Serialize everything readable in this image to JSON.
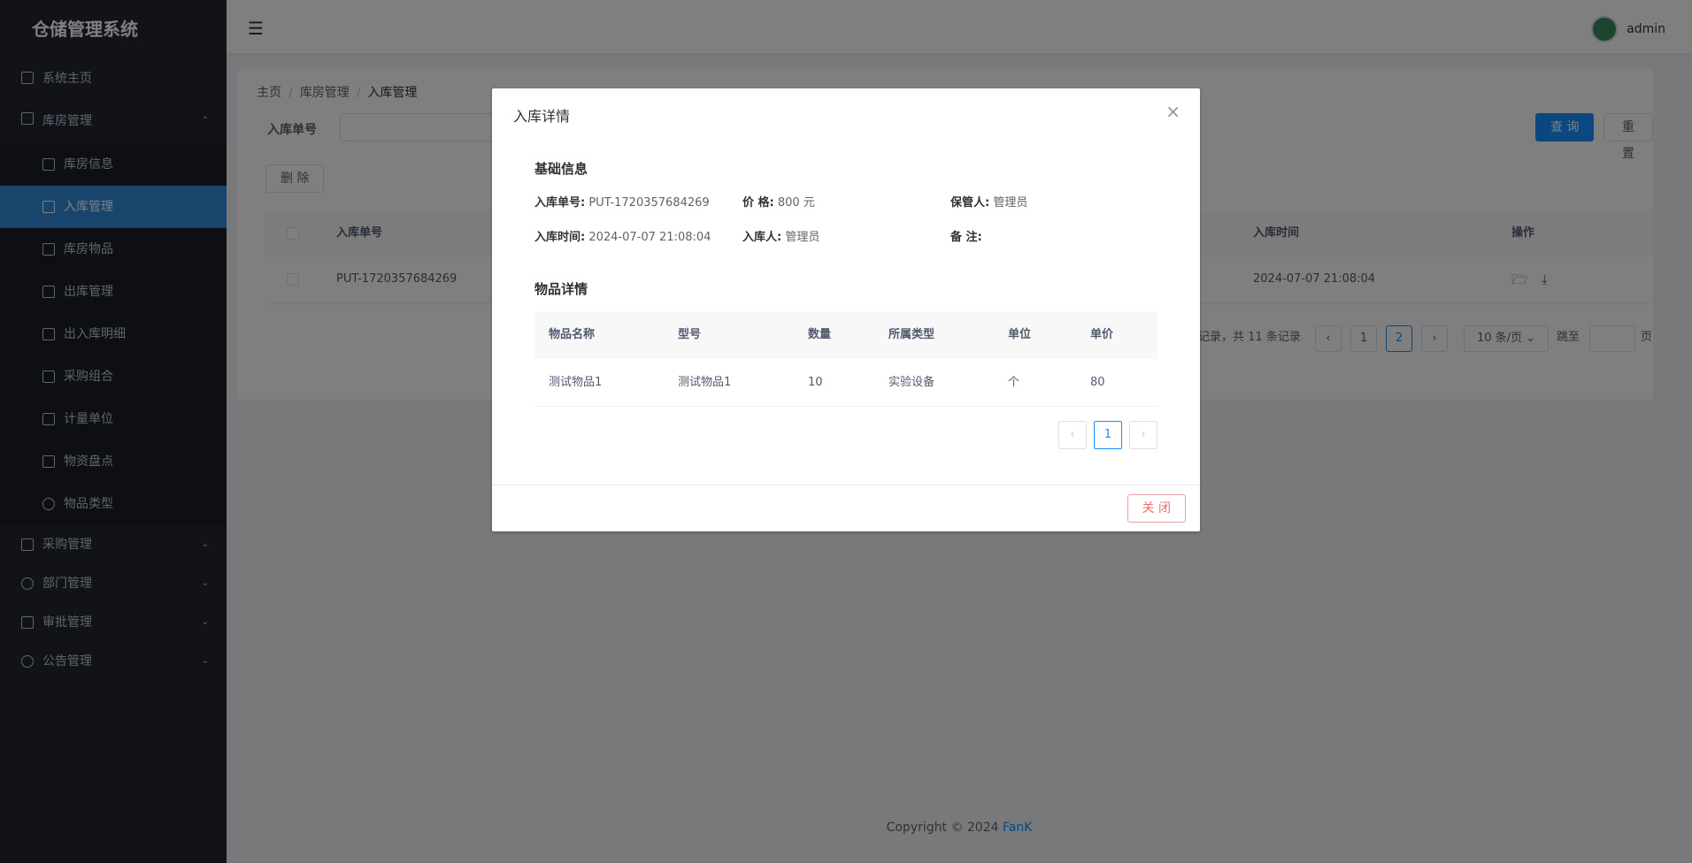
{
  "app": {
    "title": "仓储管理系统"
  },
  "sidebar": {
    "items": [
      {
        "label": "系统主页",
        "icon": "home-icon"
      },
      {
        "label": "库房管理",
        "icon": "lock-icon",
        "arrow": "⌃"
      },
      {
        "label": "库房信息",
        "icon": "card-icon"
      },
      {
        "label": "入库管理",
        "icon": "inbox-icon"
      },
      {
        "label": "库房物品",
        "icon": "grid-icon"
      },
      {
        "label": "出库管理",
        "icon": "people-icon"
      },
      {
        "label": "出入库明细",
        "icon": "chart-icon"
      },
      {
        "label": "采购组合",
        "icon": "box-icon"
      },
      {
        "label": "计量单位",
        "icon": "barcode-icon"
      },
      {
        "label": "物资盘点",
        "icon": "doc-icon"
      },
      {
        "label": "物品类型",
        "icon": "spinner-icon"
      },
      {
        "label": "采购管理",
        "icon": "doc-icon",
        "arrow": "⌄"
      },
      {
        "label": "部门管理",
        "icon": "user-icon",
        "arrow": "⌄"
      },
      {
        "label": "审批管理",
        "icon": "frame-icon",
        "arrow": "⌄"
      },
      {
        "label": "公告管理",
        "icon": "chat-icon",
        "arrow": "⌄"
      }
    ]
  },
  "header": {
    "menu_icon": "hamburger-icon",
    "username": "admin"
  },
  "breadcrumb": {
    "home": "主页",
    "parent": "库房管理",
    "current": "入库管理"
  },
  "search": {
    "label": "入库单号",
    "query_label": "查 询",
    "reset_label": "重 置"
  },
  "toolbar": {
    "delete_label": "删 除"
  },
  "table": {
    "headers": {
      "code": "入库单号",
      "time": "入库时间",
      "ops": "操作"
    },
    "rows": [
      {
        "code": "PUT-1720357684269",
        "time": "2024-07-07 21:08:04"
      }
    ]
  },
  "pagination": {
    "summary": "记录，共 11 条记录",
    "pages": [
      "1",
      "2"
    ],
    "page_size": "10 条/页",
    "goto_label": "跳至",
    "page_suffix": "页"
  },
  "footer": {
    "copyright": "Copyright © 2024",
    "author": "FanK"
  },
  "modal": {
    "title": "入库详情",
    "basic_section": "基础信息",
    "fields": {
      "code_label": "入库单号:",
      "code_value": "PUT-1720357684269",
      "price_label": "价 格:",
      "price_value": "800 元",
      "keeper_label": "保管人:",
      "keeper_value": "管理员",
      "time_label": "入库时间:",
      "time_value": "2024-07-07 21:08:04",
      "person_label": "入库人:",
      "person_value": "管理员",
      "note_label": "备 注:",
      "note_value": ""
    },
    "items_section": "物品详情",
    "item_headers": [
      "物品名称",
      "型号",
      "数量",
      "所属类型",
      "单位",
      "单价"
    ],
    "item_rows": [
      [
        "测试物品1",
        "测试物品1",
        "10",
        "实验设备",
        "个",
        "80"
      ]
    ],
    "page": "1",
    "close_label": "关 闭"
  }
}
